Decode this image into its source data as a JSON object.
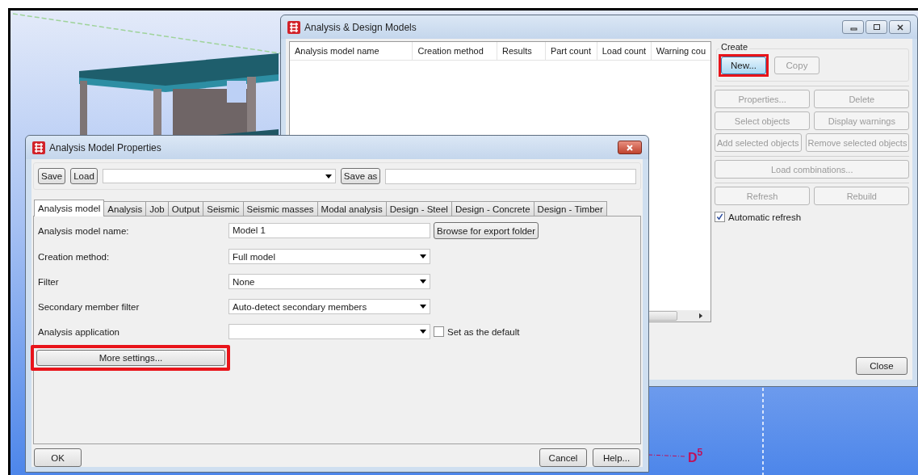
{
  "viewport": {
    "grid_label": {
      "text": "D",
      "superscript": "5"
    }
  },
  "models_window": {
    "title": "Analysis & Design Models",
    "columns": [
      "Analysis model name",
      "Creation method",
      "Results",
      "Part count",
      "Load count",
      "Warning cou"
    ],
    "create_group": {
      "label": "Create",
      "buttons": [
        {
          "label": "New...",
          "disabled": false,
          "highlighted": true
        },
        {
          "label": "Copy",
          "disabled": true,
          "highlighted": false
        }
      ]
    },
    "sections": [
      {
        "rows": [
          {
            "buttons": [
              {
                "label": "Properties...",
                "disabled": true
              },
              {
                "label": "Delete",
                "disabled": true
              }
            ]
          },
          {
            "buttons": [
              {
                "label": "Select objects",
                "disabled": true
              },
              {
                "label": "Display warnings",
                "disabled": true
              }
            ]
          },
          {
            "buttons": [
              {
                "label": "Add selected objects",
                "disabled": true
              },
              {
                "label": "Remove selected objects",
                "disabled": true
              }
            ]
          }
        ]
      },
      {
        "rows": [
          {
            "buttons": [
              {
                "label": "Load combinations...",
                "disabled": true
              }
            ]
          }
        ]
      },
      {
        "rows": [
          {
            "buttons": [
              {
                "label": "Refresh",
                "disabled": true
              },
              {
                "label": "Rebuild",
                "disabled": true
              }
            ]
          }
        ]
      }
    ],
    "auto_refresh": {
      "label": "Automatic refresh",
      "checked": true
    },
    "close_button": "Close"
  },
  "properties_window": {
    "title": "Analysis Model Properties",
    "toolbar": {
      "save_button": "Save",
      "load_button": "Load",
      "save_as_button": "Save as"
    },
    "tabs": [
      {
        "label": "Analysis model",
        "selected": true
      },
      {
        "label": "Analysis",
        "selected": false
      },
      {
        "label": "Job",
        "selected": false
      },
      {
        "label": "Output",
        "selected": false
      },
      {
        "label": "Seismic",
        "selected": false
      },
      {
        "label": "Seismic masses",
        "selected": false
      },
      {
        "label": "Modal analysis",
        "selected": false
      },
      {
        "label": "Design - Steel",
        "selected": false
      },
      {
        "label": "Design - Concrete",
        "selected": false
      },
      {
        "label": "Design - Timber",
        "selected": false
      }
    ],
    "fields": [
      {
        "label": "Analysis model name:",
        "kind": "text",
        "value": "Model 1",
        "button": "Browse for export folder"
      },
      {
        "label": "Creation method:",
        "kind": "dropdown",
        "value": "Full model"
      },
      {
        "label": "Filter",
        "kind": "dropdown",
        "value": "None"
      },
      {
        "label": "Secondary member filter",
        "kind": "dropdown",
        "value": "Auto-detect secondary members"
      },
      {
        "label": "Analysis application",
        "kind": "dropdown",
        "checkbox": {
          "label": "Set as the default",
          "checked": false
        }
      }
    ],
    "more_settings": {
      "label": "More settings...",
      "highlighted": true
    },
    "ok_button": "OK",
    "cancel_button": "Cancel",
    "help_button": "Help..."
  }
}
